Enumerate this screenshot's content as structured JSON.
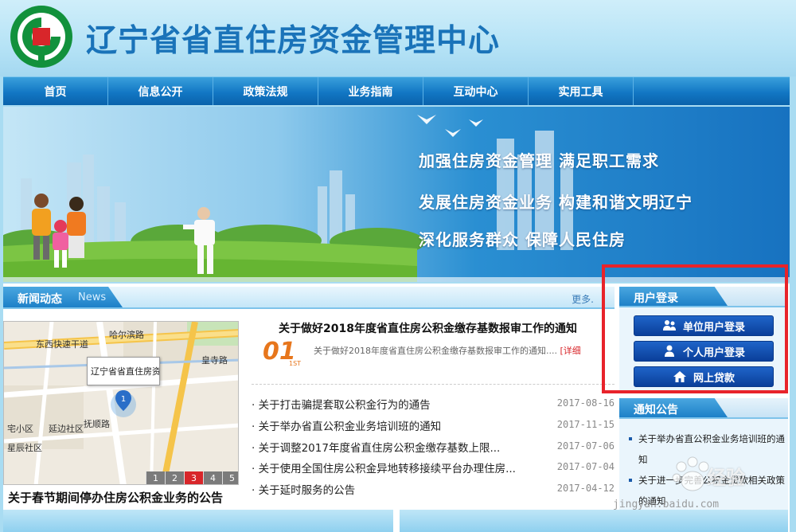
{
  "header": {
    "site_title": "辽宁省省直住房资金管理中心",
    "brand_color": "#1a73b9",
    "logo_accent": "#d8262a",
    "logo_ring": "#12913c"
  },
  "nav": {
    "items": [
      "首页",
      "信息公开",
      "政策法规",
      "业务指南",
      "互动中心",
      "实用工具"
    ]
  },
  "banner": {
    "slogans": [
      "加强住房资金管理 满足职工需求",
      "发展住房资金业务 构建和谐文明辽宁",
      "深化服务群众 保障人民住房"
    ]
  },
  "news": {
    "title": "新闻动态",
    "title_en": "News",
    "more": "更多.",
    "featured": {
      "number": "01",
      "number_sub": "1ST",
      "title": "关于做好2018年度省直住房公积金缴存基数报审工作的通知",
      "summary": "关于做好2018年度省直住房公积金缴存基数报审工作的通知....",
      "detail": "[详细"
    },
    "items": [
      {
        "title": "· 关于打击骗提套取公积金行为的通告",
        "date": "2017-08-16"
      },
      {
        "title": "· 关于举办省直公积金业务培训班的通知",
        "date": "2017-11-15"
      },
      {
        "title": "· 关于调整2017年度省直住房公积金缴存基数上限...",
        "date": "2017-07-06"
      },
      {
        "title": "· 关于使用全国住房公积金异地转移接续平台办理住房...",
        "date": "2017-07-04"
      },
      {
        "title": "· 关于延时服务的公告",
        "date": "2017-04-12"
      }
    ]
  },
  "map": {
    "labels": {
      "road1": "东西快速干道",
      "road2": "哈尔滨路",
      "road3": "抚顺路",
      "area1": "宅小区",
      "area2": "延边社区",
      "area3": "星辰社区",
      "area4": "皇寺路"
    },
    "popup": "辽宁省省直住房资...",
    "marker": "1",
    "pages": [
      "1",
      "2",
      "3",
      "4",
      "5"
    ],
    "active_page": "3",
    "caption": "关于春节期间停办住房公积金业务的公告"
  },
  "login": {
    "title": "用户登录",
    "buttons": [
      {
        "label": "单位用户登录",
        "icon": "users-icon"
      },
      {
        "label": "个人用户登录",
        "icon": "user-icon"
      },
      {
        "label": "网上贷款",
        "icon": "home-icon"
      }
    ],
    "highlight_color": "#e8232a"
  },
  "notice": {
    "title": "通知公告",
    "items": [
      "关于举办省直公积金业务培训班的通知",
      "关于进一步完善公积金贷款相关政策的通知"
    ]
  },
  "watermark": {
    "text": "经验",
    "url": "jingyan.baidu.com"
  }
}
